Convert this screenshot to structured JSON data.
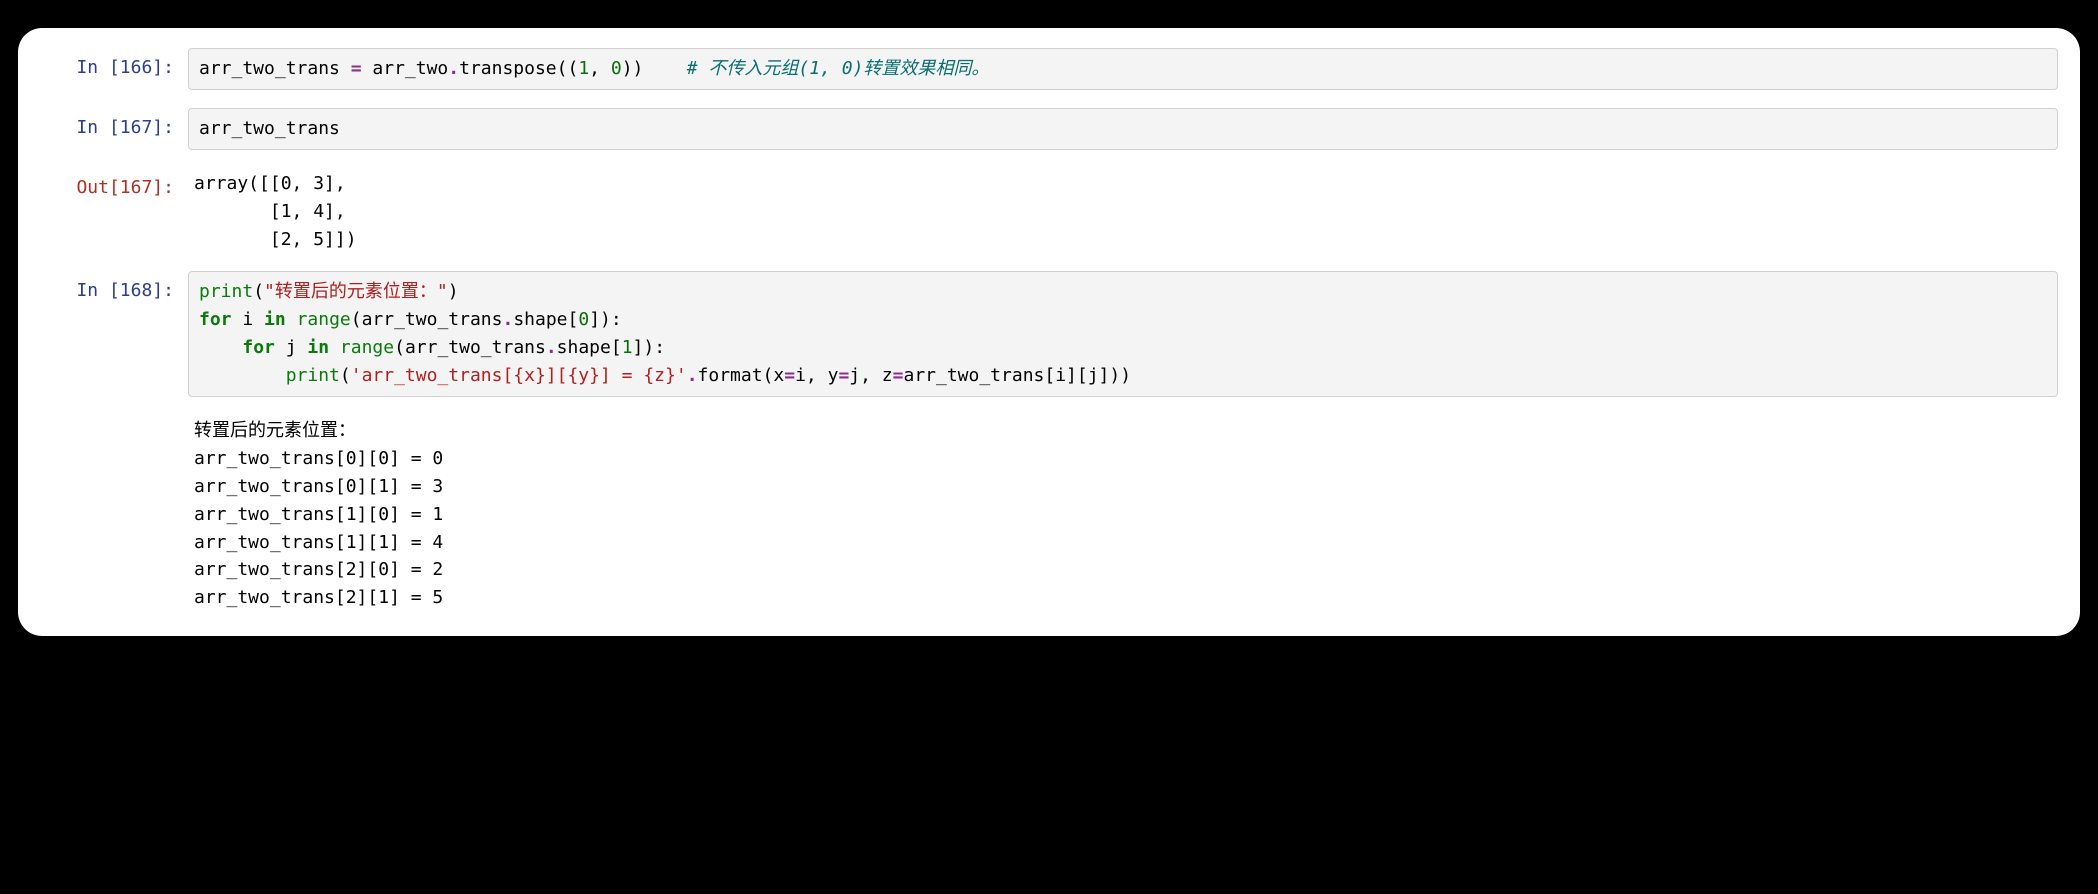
{
  "cells": {
    "c0": {
      "prompt": "In [166]:",
      "tokens": {
        "t1": "arr_two_trans ",
        "t2": "=",
        "t3": " arr_two",
        "t4": ".",
        "t5": "transpose((",
        "t6": "1",
        "t7": ", ",
        "t8": "0",
        "t9": "))    ",
        "t10": "# 不传入元组(1, 0)转置效果相同。"
      }
    },
    "c1": {
      "prompt": "In [167]:",
      "code": "arr_two_trans"
    },
    "c2": {
      "prompt": "Out[167]:",
      "text": "array([[0, 3],\n       [1, 4],\n       [2, 5]])"
    },
    "c3": {
      "prompt": "In [168]:",
      "tokens": {
        "l1a": "print",
        "l1b": "(",
        "l1c": "\"转置后的元素位置：\"",
        "l1d": ")",
        "l2a": "for",
        "l2b": " i ",
        "l2c": "in",
        "l2d": " ",
        "l2e": "range",
        "l2f": "(arr_two_trans",
        "l2g": ".",
        "l2h": "shape[",
        "l2i": "0",
        "l2j": "]):",
        "l3a": "    ",
        "l3b": "for",
        "l3c": " j ",
        "l3d": "in",
        "l3e": " ",
        "l3f": "range",
        "l3g": "(arr_two_trans",
        "l3h": ".",
        "l3i": "shape[",
        "l3j": "1",
        "l3k": "]):",
        "l4a": "        ",
        "l4b": "print",
        "l4c": "(",
        "l4d": "'arr_two_trans[{x}][{y}] = {z}'",
        "l4e": ".",
        "l4f": "format(x",
        "l4g": "=",
        "l4h": "i, y",
        "l4i": "=",
        "l4j": "j, z",
        "l4k": "=",
        "l4l": "arr_two_trans[i][j]))"
      }
    },
    "c4": {
      "text": "转置后的元素位置：\narr_two_trans[0][0] = 0\narr_two_trans[0][1] = 3\narr_two_trans[1][0] = 1\narr_two_trans[1][1] = 4\narr_two_trans[2][0] = 2\narr_two_trans[2][1] = 5"
    }
  }
}
